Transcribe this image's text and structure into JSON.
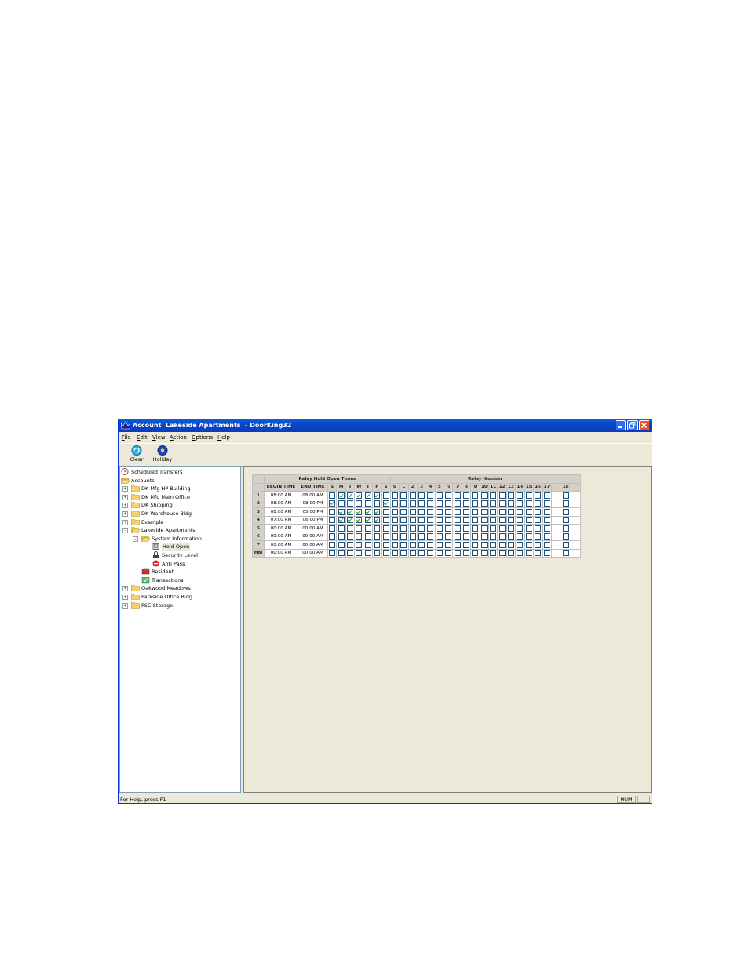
{
  "window": {
    "title": "Account  Lakeside Apartments  - DoorKing32"
  },
  "menu": [
    {
      "underline": "F",
      "rest": "ile"
    },
    {
      "underline": "E",
      "rest": "dit"
    },
    {
      "underline": "V",
      "rest": "iew"
    },
    {
      "underline": "A",
      "rest": "ction"
    },
    {
      "underline": "O",
      "rest": "ptions"
    },
    {
      "underline": "H",
      "rest": "elp"
    }
  ],
  "toolbar": {
    "clear_label": "Clear",
    "holiday_label": "Holiday"
  },
  "tree": [
    {
      "label": "Scheduled Transfers",
      "icon": "clock-icon",
      "level": 0,
      "expander": ""
    },
    {
      "label": "Accounts",
      "icon": "open-folder-icon",
      "level": 0,
      "expander": ""
    },
    {
      "label": "DK Mfg HP Building",
      "icon": "folder-icon",
      "level": 1,
      "expander": "+"
    },
    {
      "label": "DK Mfg Main Office",
      "icon": "folder-icon",
      "level": 1,
      "expander": "+"
    },
    {
      "label": "DK Shipping",
      "icon": "folder-icon",
      "level": 1,
      "expander": "+"
    },
    {
      "label": "DK Warehouse Bldg",
      "icon": "folder-icon",
      "level": 1,
      "expander": "+"
    },
    {
      "label": "Example",
      "icon": "folder-icon",
      "level": 1,
      "expander": "+"
    },
    {
      "label": "Lakeside Apartments",
      "icon": "open-folder-icon",
      "level": 1,
      "expander": "-"
    },
    {
      "label": "System Information",
      "icon": "open-folder-icon",
      "level": 2,
      "expander": "-"
    },
    {
      "label": "Hold Open",
      "icon": "door-icon",
      "level": 3,
      "expander": "",
      "selected": true
    },
    {
      "label": "Security Level",
      "icon": "lock-icon",
      "level": 3,
      "expander": ""
    },
    {
      "label": "Anti Pass",
      "icon": "no-entry-icon",
      "level": 3,
      "expander": ""
    },
    {
      "label": "Resident",
      "icon": "resident-icon",
      "level": 2,
      "expander": ""
    },
    {
      "label": "Transactions",
      "icon": "transactions-icon",
      "level": 2,
      "expander": ""
    },
    {
      "label": "Oakwood Meadows",
      "icon": "folder-icon",
      "level": 1,
      "expander": "+"
    },
    {
      "label": "Parkside Office Bldg",
      "icon": "folder-icon",
      "level": 1,
      "expander": "+"
    },
    {
      "label": "PSC Storage",
      "icon": "folder-icon",
      "level": 1,
      "expander": "+"
    }
  ],
  "grid": {
    "group_header_times": "Relay Hold Open Times",
    "group_header_relays": "Relay Number",
    "col_begin": "BEGIN TIME",
    "col_end": "END TIME",
    "days": [
      "S",
      "M",
      "T",
      "W",
      "T",
      "F",
      "S"
    ],
    "relays": [
      "0",
      "1",
      "2",
      "3",
      "4",
      "5",
      "6",
      "7",
      "8",
      "9",
      "10",
      "11",
      "12",
      "13",
      "14",
      "15",
      "16",
      "17",
      "18"
    ],
    "rows": [
      {
        "id": "1",
        "begin": "08:00 AM",
        "end": "08:00 AM",
        "days": [
          false,
          true,
          true,
          true,
          true,
          true,
          false
        ],
        "relays": []
      },
      {
        "id": "2",
        "begin": "08:00 AM",
        "end": "08:00 PM",
        "days": [
          true,
          false,
          false,
          false,
          false,
          false,
          true
        ],
        "relays": []
      },
      {
        "id": "3",
        "begin": "08:00 AM",
        "end": "05:00 PM",
        "days": [
          false,
          true,
          true,
          true,
          true,
          true,
          false
        ],
        "relays": []
      },
      {
        "id": "4",
        "begin": "07:00 AM",
        "end": "06:00 PM",
        "days": [
          false,
          true,
          true,
          true,
          true,
          true,
          false
        ],
        "relays": []
      },
      {
        "id": "5",
        "begin": "00:00 AM",
        "end": "00:00 AM",
        "days": [
          false,
          false,
          false,
          false,
          false,
          false,
          false
        ],
        "relays": []
      },
      {
        "id": "6",
        "begin": "00:00 AM",
        "end": "00:00 AM",
        "days": [
          false,
          false,
          false,
          false,
          false,
          false,
          false
        ],
        "relays": []
      },
      {
        "id": "7",
        "begin": "00:00 AM",
        "end": "00:00 AM",
        "days": [
          false,
          false,
          false,
          false,
          false,
          false,
          false
        ],
        "relays": []
      },
      {
        "id": "Hol",
        "begin": "00:00 AM",
        "end": "00:00 AM",
        "days": [
          false,
          false,
          false,
          false,
          false,
          false,
          false
        ],
        "relays": []
      }
    ]
  },
  "status": {
    "help_text": "For Help, press F1",
    "num_indicator": "NUM"
  }
}
